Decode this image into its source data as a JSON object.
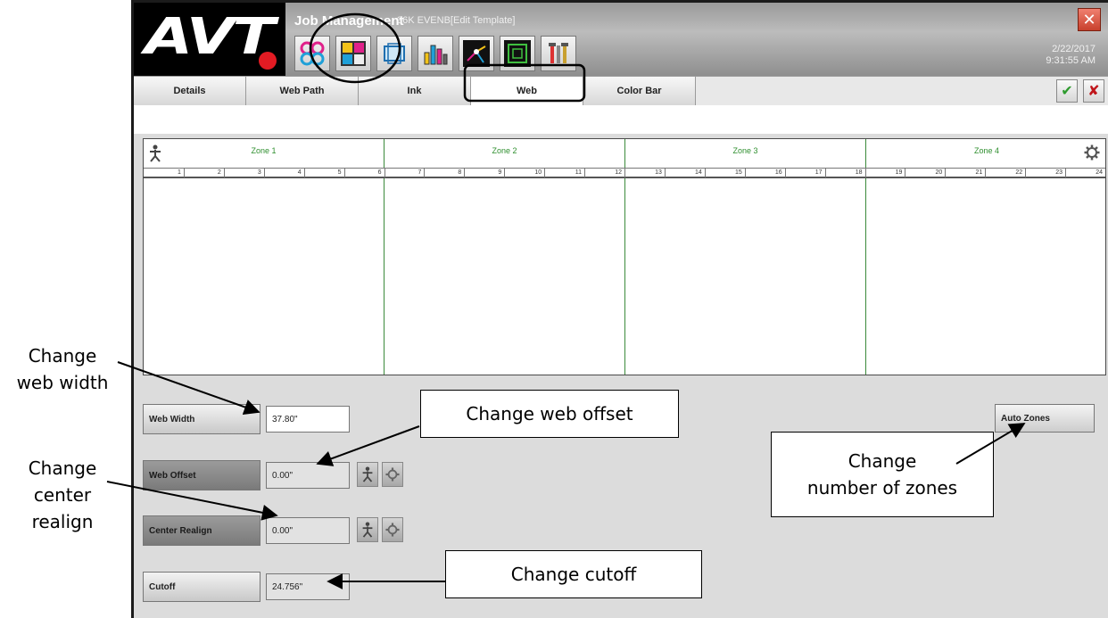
{
  "window": {
    "logo": "AVT",
    "title": "Job Management",
    "subtitle": "36K EVENB[Edit Template]",
    "date": "2/22/2017",
    "time": "9:31:55 AM",
    "close_icon": "close-icon"
  },
  "toolbar": {
    "icons": [
      "zones-icon",
      "web-template-icon",
      "frame-icon",
      "bar-graph-icon",
      "network-graph-icon",
      "target-frame-icon",
      "tools-icon"
    ]
  },
  "tabs": [
    {
      "label": "Details"
    },
    {
      "label": "Web Path"
    },
    {
      "label": "Ink"
    },
    {
      "label": "Web",
      "active": true
    },
    {
      "label": "Color Bar"
    }
  ],
  "zones": {
    "names": [
      "Zone 1",
      "Zone 2",
      "Zone 3",
      "Zone 4"
    ],
    "keys": [
      "1",
      "2",
      "3",
      "4",
      "5",
      "6",
      "7",
      "8",
      "9",
      "10",
      "11",
      "12",
      "13",
      "14",
      "15",
      "16",
      "17",
      "18",
      "19",
      "20",
      "21",
      "22",
      "23",
      "24"
    ]
  },
  "controls": {
    "web_width": {
      "label": "Web Width",
      "value": "37.80\""
    },
    "web_offset": {
      "label": "Web Offset",
      "value": "0.00\""
    },
    "center_realign": {
      "label": "Center Realign",
      "value": "0.00\""
    },
    "cutoff": {
      "label": "Cutoff",
      "value": "24.756\""
    },
    "auto_zones": {
      "label": "Auto Zones"
    }
  },
  "annotations": {
    "web_width": "Change\nweb width",
    "web_offset": "Change web offset",
    "center_realign": "Change\ncenter\nrealign",
    "zones": "Change\nnumber of zones",
    "cutoff": "Change cutoff"
  },
  "colors": {
    "zone_green": "#2f8f2f",
    "accept": "#2e9b2e",
    "reject": "#c0161b",
    "logo_dot": "#e31b23"
  }
}
